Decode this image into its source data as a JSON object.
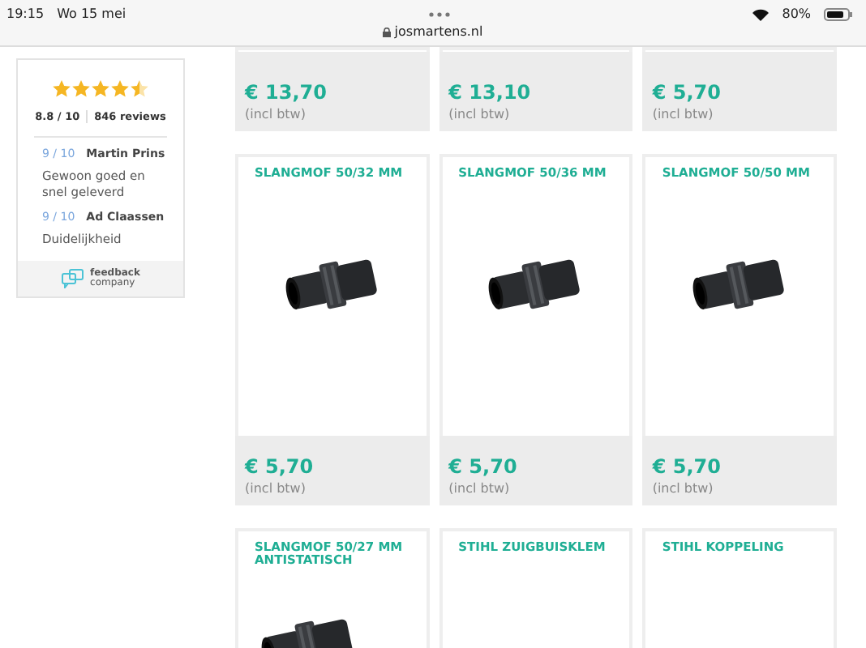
{
  "status_bar": {
    "time": "19:15",
    "date": "Wo 15 mei",
    "url": "josmartens.nl",
    "battery": "80%"
  },
  "review_widget": {
    "stars": 4.5,
    "score": "8.8 / 10",
    "count": "846 reviews",
    "reviews": [
      {
        "score": "9 / 10",
        "author": "Martin Prins",
        "text": "Gewoon goed en snel geleverd"
      },
      {
        "score": "9 / 10",
        "author": "Ad Claassen",
        "text": "Duidelijkheid"
      }
    ],
    "brand_line1": "feedback",
    "brand_line2": "company"
  },
  "product_rows": [
    {
      "kind": "price-only",
      "products": [
        {
          "price": "€ 13,70",
          "tax_note": "(incl btw)"
        },
        {
          "price": "€ 13,10",
          "tax_note": "(incl btw)"
        },
        {
          "price": "€ 5,70",
          "tax_note": "(incl btw)"
        }
      ]
    },
    {
      "kind": "full",
      "products": [
        {
          "title": "SLANGMOF 50/32 MM",
          "image": true,
          "price": "€ 5,70",
          "tax_note": "(incl btw)"
        },
        {
          "title": "SLANGMOF 50/36 MM",
          "image": true,
          "price": "€ 5,70",
          "tax_note": "(incl btw)"
        },
        {
          "title": "SLANGMOF 50/50 MM",
          "image": true,
          "price": "€ 5,70",
          "tax_note": "(incl btw)"
        }
      ]
    },
    {
      "kind": "title-only",
      "products": [
        {
          "title": "SLANGMOF 50/27 MM ANTISTATISCH",
          "image": true
        },
        {
          "title": "STIHL ZUIGBUISKLEM",
          "image": false
        },
        {
          "title": "STIHL KOPPELING",
          "image": false
        }
      ]
    }
  ]
}
